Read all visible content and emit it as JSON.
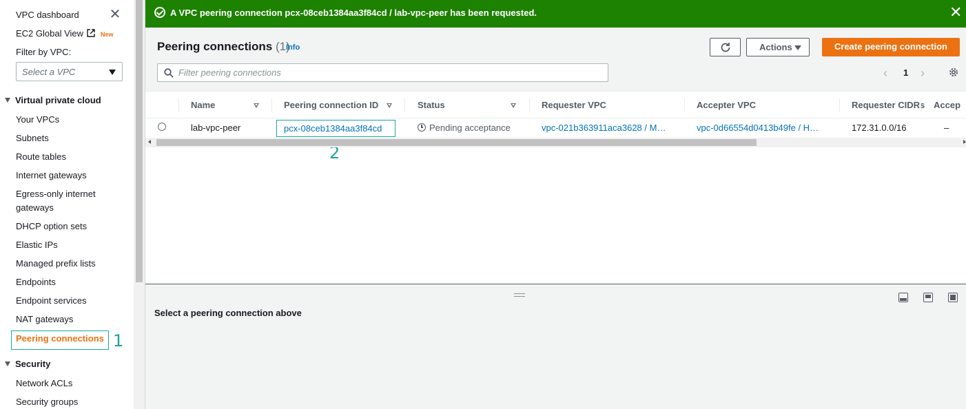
{
  "sidebar": {
    "dashboard": "VPC dashboard",
    "ec2_global_view": "EC2 Global View",
    "new_badge": "New",
    "filter_label": "Filter by VPC:",
    "filter_placeholder": "Select a VPC",
    "section_vpc": "Virtual private cloud",
    "vpc_items": [
      "Your VPCs",
      "Subnets",
      "Route tables",
      "Internet gateways",
      "Egress-only internet",
      "gateways",
      "DHCP option sets",
      "Elastic IPs",
      "Managed prefix lists",
      "Endpoints",
      "Endpoint services",
      "NAT gateways"
    ],
    "active_item": "Peering connections",
    "section_security": "Security",
    "security_items": [
      "Network ACLs",
      "Security groups"
    ]
  },
  "annotations": {
    "one": "1",
    "two": "2"
  },
  "flash": {
    "message": "A VPC peering connection pcx-08ceb1384aa3f84cd / lab-vpc-peer has been requested.",
    "type": "success"
  },
  "header": {
    "title": "Peering connections",
    "count": "(1)",
    "info": "Info",
    "actions_label": "Actions",
    "create_label": "Create peering connection"
  },
  "search": {
    "placeholder": "Filter peering connections",
    "value": ""
  },
  "pagination": {
    "current_page": "1"
  },
  "table": {
    "columns": [
      "Name",
      "Peering connection ID",
      "Status",
      "Requester VPC",
      "Accepter VPC",
      "Requester CIDRs",
      "Accep"
    ],
    "rows": [
      {
        "name": "lab-vpc-peer",
        "id": "pcx-08ceb1384aa3f84cd",
        "status": "Pending acceptance",
        "requester_vpc": "vpc-021b363911aca3628 / M…",
        "accepter_vpc": "vpc-0d66554d0413b49fe / H…",
        "requester_cidrs": "172.31.0.0/16",
        "accepter_cidrs": "–"
      }
    ]
  },
  "split_panel": {
    "message": "Select a peering connection above"
  },
  "colors": {
    "success": "#1d8102",
    "primary": "#ec7211",
    "link": "#0073bb",
    "annotation": "#1aa59c"
  }
}
